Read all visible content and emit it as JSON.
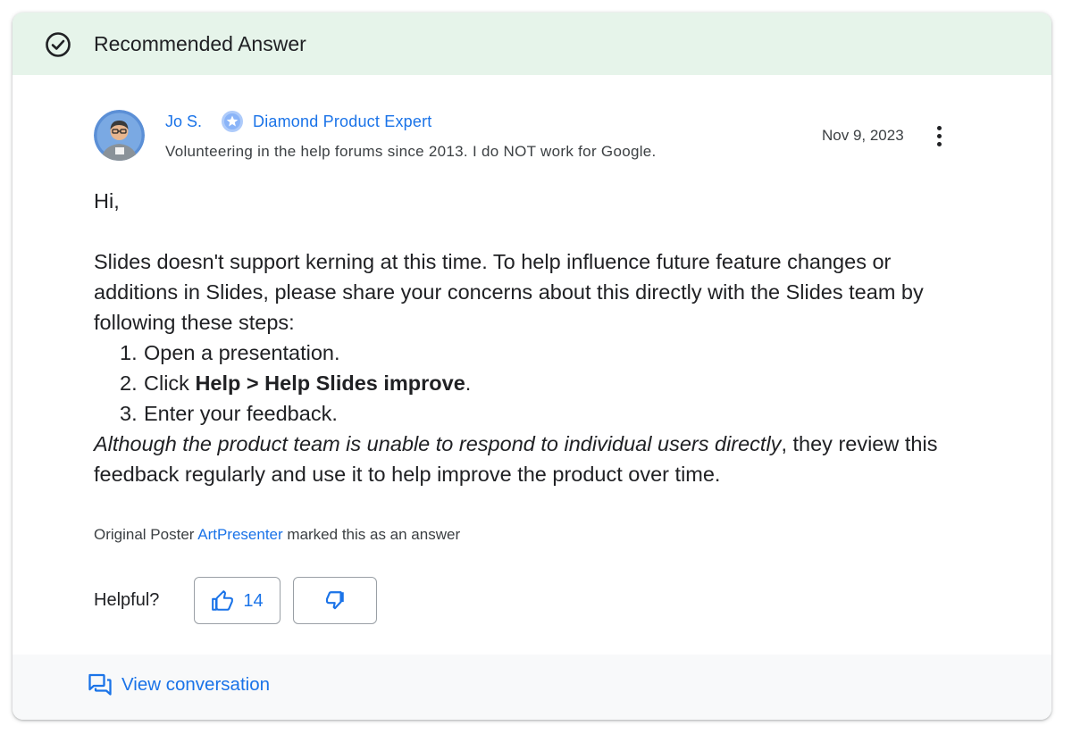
{
  "header": {
    "title": "Recommended Answer",
    "icon": "check-circle-icon"
  },
  "author": {
    "name": "Jo S.",
    "badge_icon": "star-badge-icon",
    "badge_label": "Diamond Product Expert",
    "bio": "Volunteering in the help forums since 2013. I do NOT work for Google."
  },
  "post": {
    "date": "Nov 9, 2023",
    "greeting": "Hi,",
    "intro": "Slides doesn't support kerning at this time. To help influence future feature changes or additions in Slides, please share your concerns about this directly with the Slides team by following these steps:",
    "steps": [
      {
        "num": "1.",
        "text": "Open a presentation."
      },
      {
        "num": "2.",
        "prefix": "Click ",
        "bold": "Help > Help Slides improve",
        "suffix": "."
      },
      {
        "num": "3.",
        "text": "Enter your feedback."
      }
    ],
    "closing_italic": "Although the product team is unable to respond to individual users directly",
    "closing_rest": ", they review this feedback regularly and use it to help improve the product over time."
  },
  "answer_mark": {
    "prefix": "Original Poster",
    "op_name": "ArtPresenter",
    "suffix": "marked this as an answer"
  },
  "helpful": {
    "label": "Helpful?",
    "up_count": "14",
    "up_icon": "thumbs-up-icon",
    "down_icon": "thumbs-down-icon"
  },
  "footer": {
    "link_label": "View conversation",
    "icon": "forum-icon"
  },
  "colors": {
    "accent": "#1a73e8",
    "header_bg": "#e6f4ea",
    "footer_bg": "#f8f9fa",
    "text": "#202124"
  }
}
